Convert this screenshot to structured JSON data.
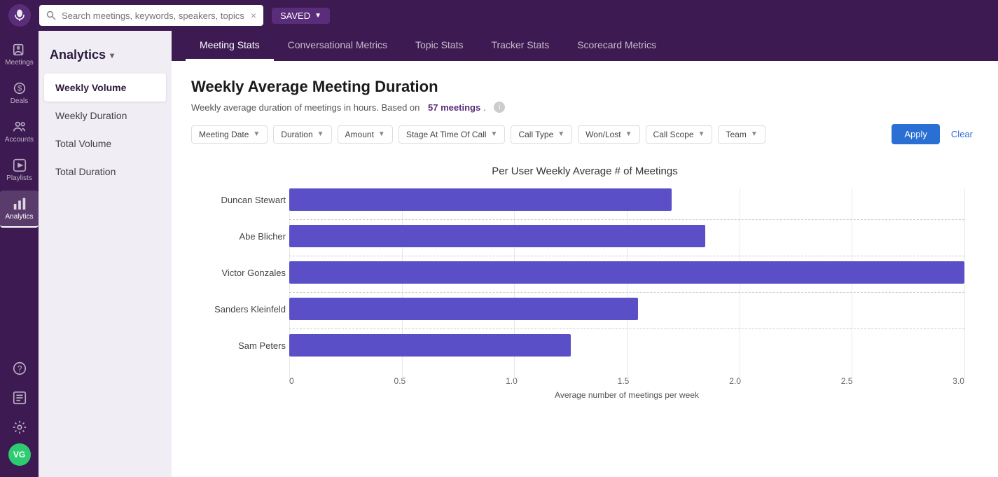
{
  "app": {
    "logo_text": "🎙",
    "search_placeholder": "Search meetings, keywords, speakers, topics"
  },
  "top_bar": {
    "saved_label": "SAVED"
  },
  "icon_rail": {
    "items": [
      {
        "id": "meetings",
        "label": "Meetings",
        "icon": "microphone"
      },
      {
        "id": "deals",
        "label": "Deals",
        "icon": "dollar"
      },
      {
        "id": "accounts",
        "label": "Accounts",
        "icon": "accounts"
      },
      {
        "id": "playlists",
        "label": "Playlists",
        "icon": "play"
      },
      {
        "id": "analytics",
        "label": "Analytics",
        "icon": "analytics",
        "active": true
      }
    ],
    "bottom_items": [
      {
        "id": "help",
        "icon": "help"
      },
      {
        "id": "scorecard",
        "icon": "scorecard"
      },
      {
        "id": "settings",
        "icon": "settings"
      }
    ],
    "avatar": "VG"
  },
  "secondary_sidebar": {
    "title": "Analytics",
    "items": [
      {
        "id": "weekly-volume",
        "label": "Weekly Volume",
        "active": true
      },
      {
        "id": "weekly-duration",
        "label": "Weekly Duration"
      },
      {
        "id": "total-volume",
        "label": "Total Volume"
      },
      {
        "id": "total-duration",
        "label": "Total Duration"
      }
    ]
  },
  "tabs": [
    {
      "id": "meeting-stats",
      "label": "Meeting Stats",
      "active": true
    },
    {
      "id": "conversational-metrics",
      "label": "Conversational Metrics"
    },
    {
      "id": "topic-stats",
      "label": "Topic Stats"
    },
    {
      "id": "tracker-stats",
      "label": "Tracker Stats"
    },
    {
      "id": "scorecard-metrics",
      "label": "Scorecard Metrics"
    }
  ],
  "page": {
    "title": "Weekly Average Meeting Duration",
    "subtitle_prefix": "Weekly average duration of meetings in hours. Based on",
    "meetings_count": "57 meetings",
    "subtitle_suffix": "."
  },
  "filters": [
    {
      "id": "meeting-date",
      "label": "Meeting Date"
    },
    {
      "id": "duration",
      "label": "Duration"
    },
    {
      "id": "amount",
      "label": "Amount"
    },
    {
      "id": "stage-at-time",
      "label": "Stage At Time Of Call"
    },
    {
      "id": "call-type",
      "label": "Call Type"
    },
    {
      "id": "won-lost",
      "label": "Won/Lost"
    },
    {
      "id": "call-scope",
      "label": "Call Scope"
    },
    {
      "id": "team",
      "label": "Team"
    }
  ],
  "buttons": {
    "apply": "Apply",
    "clear": "Clear"
  },
  "chart": {
    "title": "Per User Weekly Average # of Meetings",
    "x_axis_label": "Average number of meetings per week",
    "x_ticks": [
      "0",
      "0.5",
      "1.0",
      "1.5",
      "2.0",
      "2.5",
      "3.0"
    ],
    "bars": [
      {
        "name": "Duncan Stewart",
        "value": 1.7,
        "max": 3.0
      },
      {
        "name": "Abe Blicher",
        "value": 1.85,
        "max": 3.0
      },
      {
        "name": "Victor Gonzales",
        "value": 3.0,
        "max": 3.0
      },
      {
        "name": "Sanders Kleinfeld",
        "value": 1.55,
        "max": 3.0
      },
      {
        "name": "Sam Peters",
        "value": 1.25,
        "max": 3.0
      }
    ]
  }
}
